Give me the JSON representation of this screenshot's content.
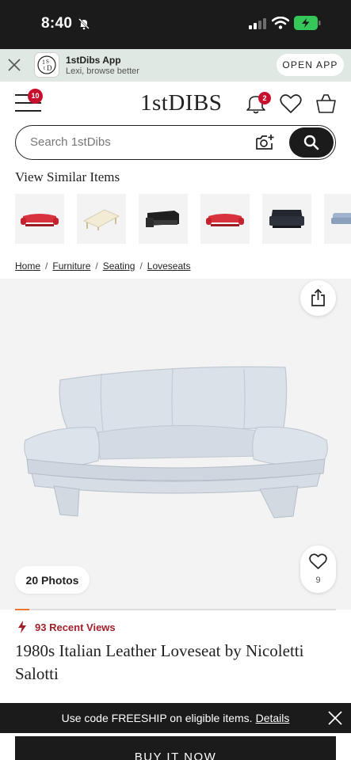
{
  "status_bar": {
    "time": "8:40"
  },
  "app_banner": {
    "title": "1stDibs App",
    "subtitle": "Lexi, browse better",
    "open_label": "OPEN APP"
  },
  "header": {
    "menu_badge": "10",
    "logo": "1stDIBS",
    "notifications_badge": "2"
  },
  "search": {
    "placeholder": "Search 1stDibs"
  },
  "similar": {
    "title": "View Similar Items",
    "items": [
      {
        "icon": "red-sofa-thumbnail",
        "color": "#d8323c"
      },
      {
        "icon": "cream-daybed-thumbnail",
        "color": "#f2ecd6"
      },
      {
        "icon": "black-sofa-thumbnail",
        "color": "#1f1f1f"
      },
      {
        "icon": "red-sofa-thumbnail",
        "color": "#d8323c"
      },
      {
        "icon": "black-armchair-thumbnail",
        "color": "#23262e"
      },
      {
        "icon": "blue-sofa-thumbnail",
        "color": "#9fb3cc"
      }
    ]
  },
  "breadcrumb": [
    "Home",
    "Furniture",
    "Seating",
    "Loveseats"
  ],
  "product": {
    "photos_label": "20 Photos",
    "favorites_count": "9",
    "gallery_progress": 0.045,
    "recent_views": "93 Recent Views",
    "title": "1980s Italian Leather Loveseat by Nicoletti Salotti"
  },
  "promo": {
    "text": "Use code FREESHIP on eligible items.",
    "link": "Details"
  },
  "cta": {
    "buy_label": "BUY IT NOW"
  },
  "colors": {
    "brand_dark": "#1b1b1b",
    "badge_red": "#c8102e",
    "views_red": "#a11f2b",
    "banner_green": "#dfe8e2",
    "progress_orange": "#e8762c"
  }
}
